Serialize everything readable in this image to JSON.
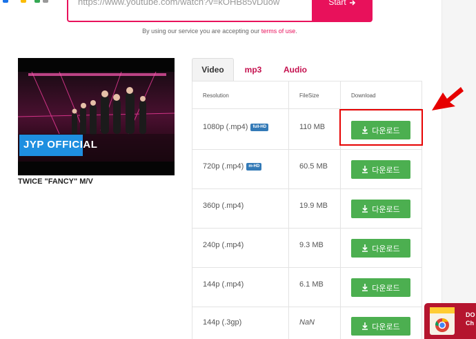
{
  "search": {
    "url_value": "https://www.youtube.com/watch?v=kOHB85vDuow",
    "start_label": "Start"
  },
  "terms": {
    "prefix": "By using our service you are accepting our ",
    "link": "terms of use",
    "suffix": "."
  },
  "video": {
    "title": "TWICE \"FANCY\" M/V",
    "logo_text": "JYP OFFICIAL"
  },
  "tabs": [
    {
      "label": "Video"
    },
    {
      "label": "mp3"
    },
    {
      "label": "Audio"
    }
  ],
  "table": {
    "headers": {
      "resolution": "Resolution",
      "filesize": "FileSize",
      "download": "Download"
    },
    "download_label": "다운로드",
    "rows": [
      {
        "resolution": "1080p (.mp4)",
        "badge": "full-HD",
        "filesize": "110 MB"
      },
      {
        "resolution": "720p (.mp4)",
        "badge": "m-HD",
        "filesize": "60.5 MB"
      },
      {
        "resolution": "360p (.mp4)",
        "badge": "",
        "filesize": "19.9 MB"
      },
      {
        "resolution": "240p (.mp4)",
        "badge": "",
        "filesize": "9.3 MB"
      },
      {
        "resolution": "144p (.mp4)",
        "badge": "",
        "filesize": "6.1 MB"
      },
      {
        "resolution": "144p (.3gp)",
        "badge": "",
        "filesize": "NaN"
      }
    ]
  },
  "extension_badge": {
    "line1": "DO",
    "line2": "Ch"
  },
  "colors": {
    "accent": "#e8115b",
    "download_green": "#4caf50",
    "badge_blue": "#337ab7",
    "highlight_red": "#e60000"
  }
}
